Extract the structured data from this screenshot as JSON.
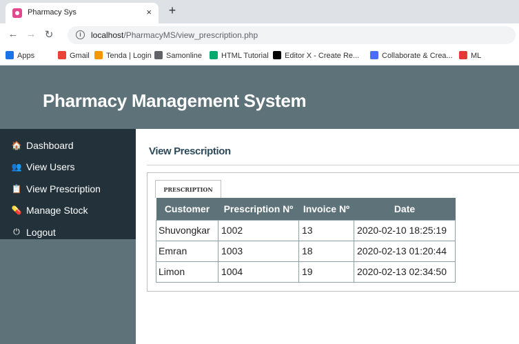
{
  "browser": {
    "tab_title": "Pharmacy Sys",
    "tab_close": "×",
    "new_tab": "+",
    "url_host": "localhost",
    "url_path": "/PharmacyMS/view_prescription.php",
    "bookmarks": [
      {
        "label": "Apps",
        "icon": "apps-grid-icon",
        "color": "#1a73e8"
      },
      {
        "label": "Gmail",
        "icon": "gmail-icon",
        "color": "#ea4335"
      },
      {
        "label": "Tenda | Login",
        "icon": "tenda-icon",
        "color": "#f29900"
      },
      {
        "label": "Samonline",
        "icon": "globe-icon",
        "color": "#5f6368"
      },
      {
        "label": "HTML Tutorial",
        "icon": "w3schools-icon",
        "color": "#04aa6d"
      },
      {
        "label": "Editor X - Create Re...",
        "icon": "editorx-icon",
        "color": "#000000"
      },
      {
        "label": "Collaborate & Crea...",
        "icon": "collaborate-icon",
        "color": "#4a6cf7"
      },
      {
        "label": "ML",
        "icon": "ml-icon",
        "color": "#e53935"
      }
    ]
  },
  "app": {
    "brand": "Pharmacy Management System",
    "colors": {
      "primary": "#5e7279",
      "sidebar": "#22313a",
      "title": "#2c4a5a"
    }
  },
  "sidebar": {
    "items": [
      {
        "label": "Dashboard",
        "icon": "home-icon",
        "glyph": "🏠"
      },
      {
        "label": "View Users",
        "icon": "users-icon",
        "glyph": "👥"
      },
      {
        "label": "View Prescription",
        "icon": "prescription-icon",
        "glyph": "📋"
      },
      {
        "label": "Manage Stock",
        "icon": "pills-icon",
        "glyph": "💊"
      },
      {
        "label": "Logout",
        "icon": "power-icon",
        "glyph": "⏻"
      }
    ]
  },
  "main": {
    "page_title": "View Prescription",
    "tab_label": "PRESCRIPTION",
    "table": {
      "headers": [
        "Customer",
        "Prescription Nº",
        "Invoice Nº",
        "Date"
      ],
      "rows": [
        [
          "Shuvongkar",
          "1002",
          "13",
          "2020-02-10 18:25:19"
        ],
        [
          "Emran",
          "1003",
          "18",
          "2020-02-13 01:20:44"
        ],
        [
          "Limon",
          "1004",
          "19",
          "2020-02-13 02:34:50"
        ]
      ]
    }
  }
}
